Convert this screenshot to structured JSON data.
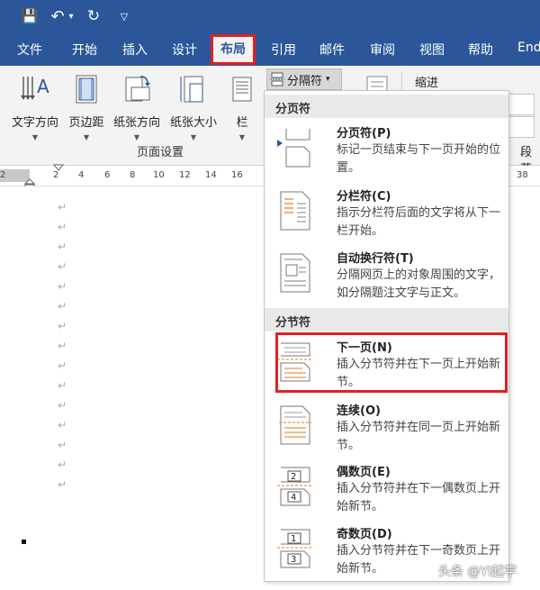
{
  "quick_access": {
    "save": "💾",
    "undo": "↶",
    "undo_dd": "▾",
    "redo": "↻",
    "customize": "▽"
  },
  "tabs": [
    "文件",
    "开始",
    "插入",
    "设计",
    "布局",
    "引用",
    "邮件",
    "审阅",
    "视图",
    "帮助",
    "End"
  ],
  "active_tab": "布局",
  "ribbon": {
    "buttons": [
      "文字方向",
      "页边距",
      "纸张方向",
      "纸张大小",
      "栏"
    ],
    "dropdown_glyph": "▼",
    "group_label": "页面设置",
    "breaks_button": "分隔符",
    "breaks_caret": "▾",
    "indent_label": "缩进",
    "paragraph_label": "段落"
  },
  "ruler_ticks": [
    "2",
    "2",
    "4",
    "6",
    "8",
    "10",
    "12",
    "14",
    "16",
    "38"
  ],
  "document": {
    "para_mark": "↵",
    "para_count": 15
  },
  "menu": {
    "section_page": "分页符",
    "section_section": "分节符",
    "items": [
      {
        "icon": "page-break-icon",
        "title": "分页符(P)",
        "desc": "标记一页结束与下一页开始的位置。"
      },
      {
        "icon": "column-break-icon",
        "title": "分栏符(C)",
        "desc": "指示分栏符后面的文字将从下一栏开始。"
      },
      {
        "icon": "text-wrapping-icon",
        "title": "自动换行符(T)",
        "desc": "分隔网页上的对象周围的文字，如分隔题注文字与正文。"
      },
      {
        "icon": "next-page-icon",
        "title": "下一页(N)",
        "desc": "插入分节符并在下一页上开始新节。"
      },
      {
        "icon": "continuous-icon",
        "title": "连续(O)",
        "desc": "插入分节符并在同一页上开始新节。"
      },
      {
        "icon": "even-page-icon",
        "title": "偶数页(E)",
        "desc": "插入分节符并在下一偶数页上开始新节。",
        "badge_top": "2",
        "badge_bottom": "4"
      },
      {
        "icon": "odd-page-icon",
        "title": "奇数页(D)",
        "desc": "插入分节符并在下一奇数页上开始新节。",
        "badge_top": "1",
        "badge_bottom": "3"
      }
    ]
  },
  "watermark": "头条 @YI起学",
  "colors": {
    "accent": "#2b579a",
    "highlight": "#e02020",
    "ribbon": "#f3f3f3"
  }
}
